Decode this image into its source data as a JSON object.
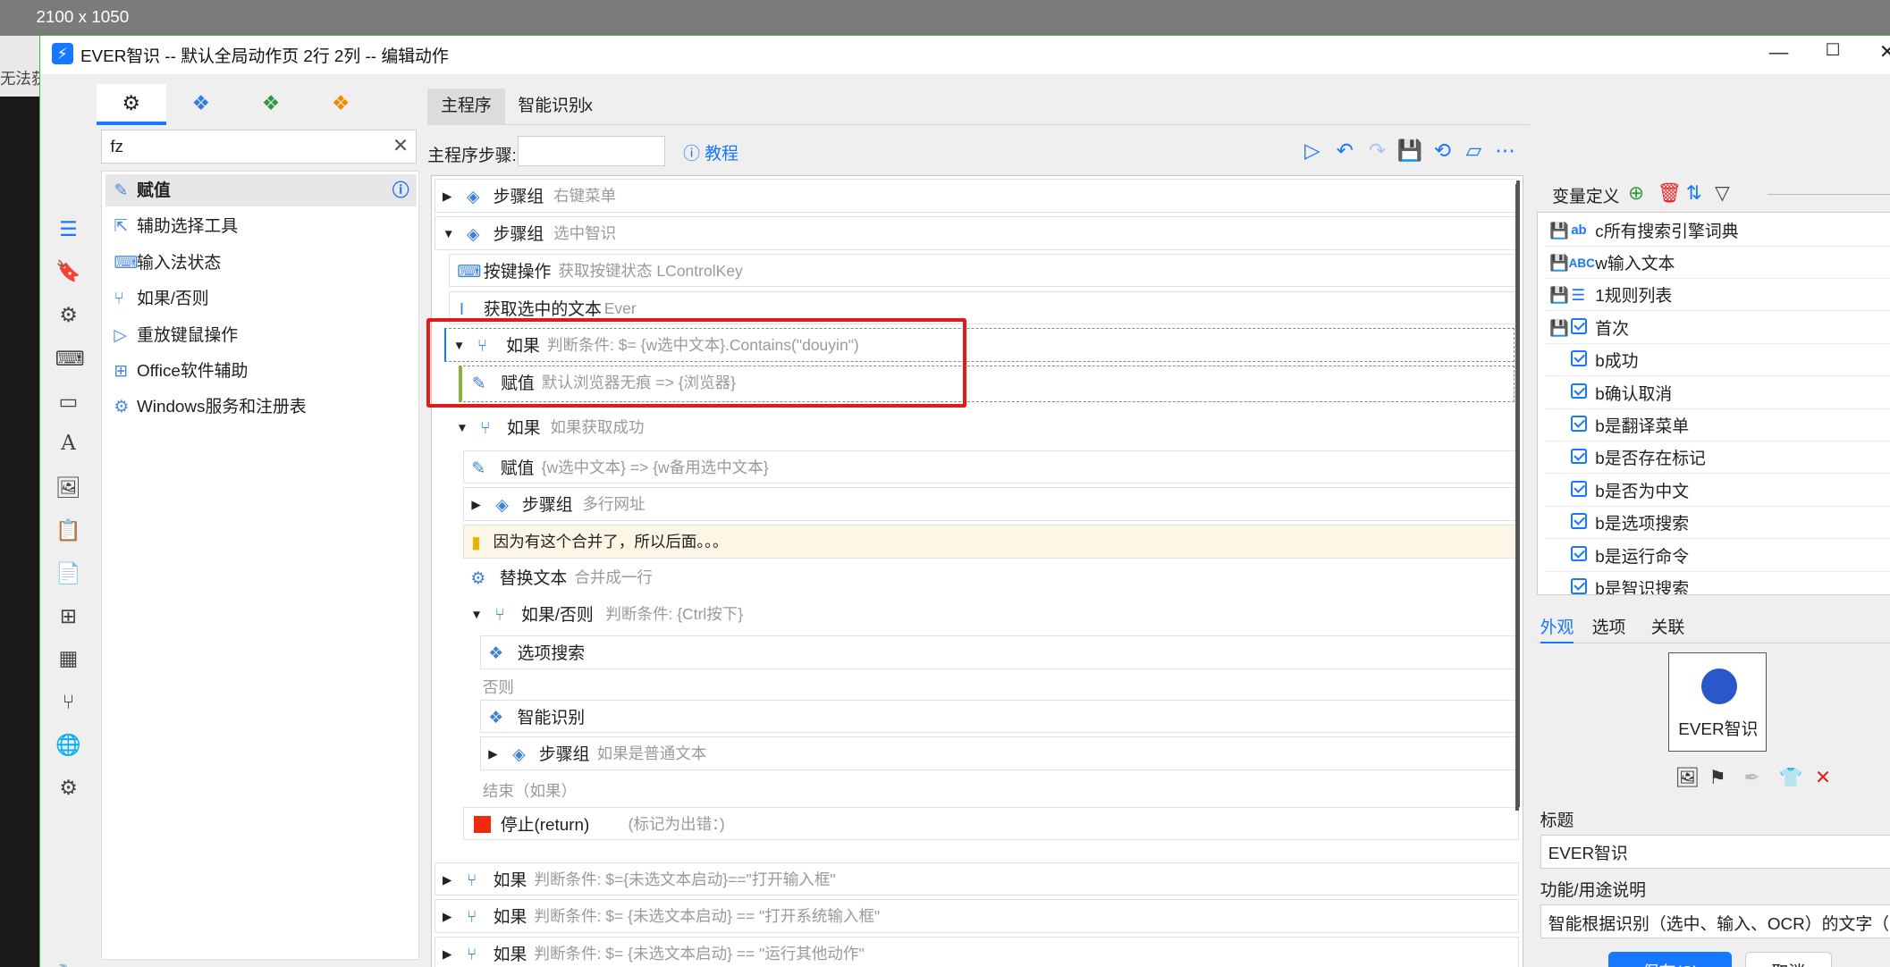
{
  "desktop": {
    "size_label": "2100 x 1050",
    "left_text": "无法获"
  },
  "window": {
    "title": "EVER智识 -- 默认全局动作页 2行 2列 -- 编辑动作",
    "minimize": "—",
    "maximize": "☐",
    "close": "✕"
  },
  "toolbox": {
    "tabs": [
      "gear-cluster-icon",
      "blue-cubes-icon",
      "green-cubes-icon",
      "orange-cubes-icon"
    ],
    "search_value": "fz",
    "items": [
      {
        "label": "赋值",
        "icon": "edit-icon"
      },
      {
        "label": "辅助选择工具",
        "icon": "pointer-icon"
      },
      {
        "label": "输入法状态",
        "icon": "keyboard-icon"
      },
      {
        "label": "如果/否则",
        "icon": "branch-icon"
      },
      {
        "label": "重放键鼠操作",
        "icon": "play-icon"
      },
      {
        "label": "Office软件辅助",
        "icon": "windows-icon"
      },
      {
        "label": "Windows服务和注册表",
        "icon": "gear-icon"
      }
    ]
  },
  "sidebar_icons": [
    "list-icon",
    "bookmark-icon",
    "gear-icon",
    "keyboard-icon",
    "window-icon",
    "font-icon",
    "image-icon",
    "clipboard-icon",
    "document-icon",
    "windows-icon",
    "calculator-icon",
    "branch-icon",
    "globe-icon",
    "gears-icon",
    "wrench-icon"
  ],
  "main": {
    "tabs": [
      "主程序",
      "智能识别",
      "x"
    ],
    "steps_label": "主程序步骤:",
    "tutorial": "教程",
    "steps": [
      {
        "name": "步骤组",
        "desc": "右键菜单"
      },
      {
        "name": "步骤组",
        "desc": "选中智识"
      },
      {
        "name": "按键操作",
        "desc": "获取按键状态 LControlKey"
      },
      {
        "name": "获取选中的文本",
        "desc": "Ever"
      },
      {
        "name": "如果",
        "desc": "判断条件: $= {w选中文本}.Contains(\"douyin\")"
      },
      {
        "name": "赋值",
        "desc": "默认浏览器无痕 => {浏览器}"
      },
      {
        "name": "如果",
        "desc": "如果获取成功"
      },
      {
        "name": "赋值",
        "desc": "{w选中文本} => {w备用选中文本}"
      },
      {
        "name": "步骤组",
        "desc": "多行网址"
      },
      {
        "name": "因为有这个合并了，所以后面。。。",
        "desc": ""
      },
      {
        "name": "替换文本",
        "desc": "合并成一行"
      },
      {
        "name": "如果/否则",
        "desc": "判断条件: {Ctrl按下}"
      },
      {
        "name": "选项搜索",
        "desc": ""
      },
      {
        "name": "否则",
        "desc": ""
      },
      {
        "name": "智能识别",
        "desc": ""
      },
      {
        "name": "步骤组",
        "desc": "如果是普通文本"
      },
      {
        "name": "结束（如果）",
        "desc": ""
      },
      {
        "name": "停止(return)",
        "desc": "(标记为出错：)"
      },
      {
        "name": "如果",
        "desc": "判断条件: $={未选文本启动}==\"打开输入框\""
      },
      {
        "name": "如果",
        "desc": "判断条件: $= {未选文本启动} == \"打开系统输入框\""
      },
      {
        "name": "如果",
        "desc": "判断条件: $= {未选文本启动} == \"运行其他动作\""
      }
    ]
  },
  "variables": {
    "header": "变量定义",
    "items": [
      {
        "type": "ab",
        "name": "c所有搜索引擎词典",
        "saved": true
      },
      {
        "type": "ABC",
        "name": "w输入文本",
        "saved": true
      },
      {
        "type": "list",
        "name": "1规则列表",
        "saved": true
      },
      {
        "type": "check",
        "name": "首次",
        "saved": true
      },
      {
        "type": "check",
        "name": "b成功",
        "saved": false
      },
      {
        "type": "check",
        "name": "b确认取消",
        "saved": false
      },
      {
        "type": "check",
        "name": "b是翻译菜单",
        "saved": false
      },
      {
        "type": "check",
        "name": "b是否存在标记",
        "saved": false
      },
      {
        "type": "check",
        "name": "b是否为中文",
        "saved": false
      },
      {
        "type": "check",
        "name": "b是选项搜索",
        "saved": false
      },
      {
        "type": "check",
        "name": "b是运行命令",
        "saved": false
      },
      {
        "type": "check",
        "name": "b是智识搜索",
        "saved": false
      }
    ]
  },
  "props": {
    "tabs": [
      "外观",
      "选项",
      "关联"
    ],
    "preview_text": "EVER智识",
    "title_label": "标题",
    "title_value": "EVER智识",
    "desc_label": "功能/用途说明",
    "desc_value": "智能根据识别（选中、输入、OCR）的文字（网",
    "save": "保存(S)",
    "cancel": "取消"
  },
  "colors": {
    "accent": "#1677ff",
    "highlight_box": "#e21a1a",
    "note_bg": "#fbf6e5",
    "stop_red": "#f02a0d"
  }
}
